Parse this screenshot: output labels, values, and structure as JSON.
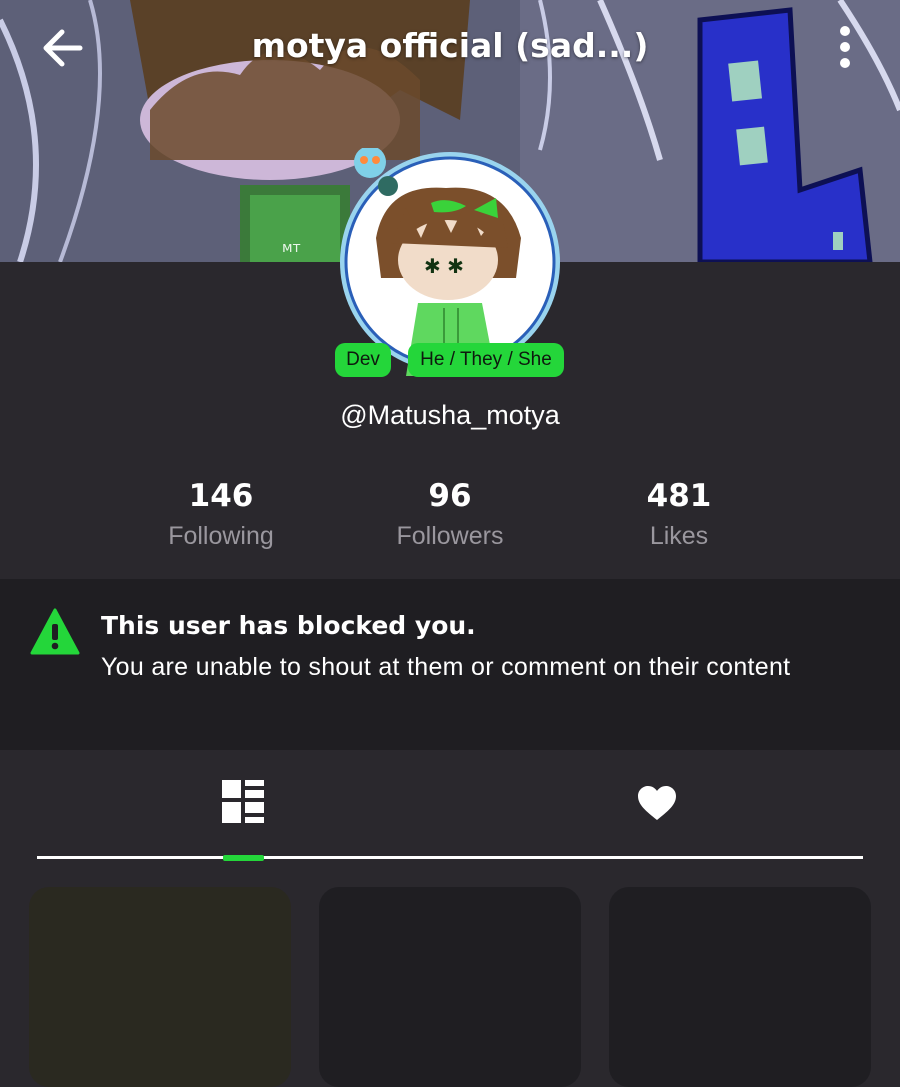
{
  "header": {
    "title": "motya official (sad...)",
    "back_icon": "arrow-left-icon",
    "menu_icon": "more-vertical-icon"
  },
  "profile": {
    "badges": [
      "Dev",
      "He / They / She"
    ],
    "handle": "@Matusha_motya"
  },
  "stats": [
    {
      "value": "146",
      "label": "Following"
    },
    {
      "value": "96",
      "label": "Followers"
    },
    {
      "value": "481",
      "label": "Likes"
    }
  ],
  "notice": {
    "icon": "warning-icon",
    "title": "This user has blocked you.",
    "text": "You are unable to shout at them or comment on their content"
  },
  "tabs": [
    {
      "icon": "grid-layout-icon",
      "active": true
    },
    {
      "icon": "heart-icon",
      "active": false
    }
  ],
  "colors": {
    "accent": "#24d63a",
    "background": "#2a282d",
    "notice_bg": "#1f1e22"
  }
}
